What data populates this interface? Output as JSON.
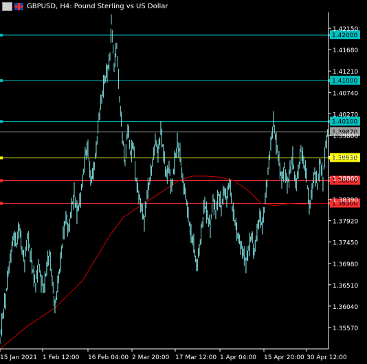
{
  "window": {
    "title": "GBPUSD, H4:  Pound Sterling vs US Dollar"
  },
  "colors": {
    "background": "#000000",
    "price": "#7fe3e3",
    "level_cyan": "#00c0c0",
    "level_yellow": "#ffff00",
    "level_red": "#ff3030",
    "ma": "#d00000",
    "axis_text": "#ffffff",
    "current_price_tag": "#a0a0a0"
  },
  "chart_data": {
    "type": "candlestick",
    "title": "GBPUSD, H4:  Pound Sterling vs US Dollar",
    "symbol": "GBPUSD",
    "timeframe": "H4",
    "ylim": [
      1.351,
      1.425
    ],
    "y_ticks": [
      "1.42150",
      "1.41680",
      "1.41210",
      "1.40740",
      "1.40270",
      "1.39800",
      "1.39330",
      "1.38860",
      "1.38390",
      "1.37920",
      "1.37450",
      "1.36980",
      "1.36510",
      "1.36040",
      "1.35570"
    ],
    "x_ticks": [
      "15 Jan 2021",
      "1 Feb 12:00",
      "16 Feb 04:00",
      "2 Mar 20:00",
      "17 Mar 12:00",
      "1 Apr 04:00",
      "15 Apr 20:00",
      "30 Apr 12:00"
    ],
    "horizontal_levels": [
      {
        "label": "1.42000",
        "value": 1.42,
        "color": "cyan"
      },
      {
        "label": "1.41000",
        "value": 1.41,
        "color": "cyan"
      },
      {
        "label": "1.40100",
        "value": 1.401,
        "color": "cyan"
      },
      {
        "label": "1.39930",
        "value": 1.393,
        "color": "yellow"
      },
      {
        "label": "1.38800",
        "value": 1.388,
        "color": "red"
      },
      {
        "label": "1.38300",
        "value": 1.383,
        "color": "red"
      }
    ],
    "current_price": {
      "label": "1.39870",
      "value": 1.3987
    },
    "price_path": [
      [
        0,
        1.353
      ],
      [
        4,
        1.358
      ],
      [
        8,
        1.362
      ],
      [
        12,
        1.368
      ],
      [
        16,
        1.372
      ],
      [
        20,
        1.376
      ],
      [
        24,
        1.374
      ],
      [
        28,
        1.378
      ],
      [
        32,
        1.373
      ],
      [
        36,
        1.37
      ],
      [
        40,
        1.376
      ],
      [
        44,
        1.372
      ],
      [
        48,
        1.368
      ],
      [
        52,
        1.365
      ],
      [
        56,
        1.37
      ],
      [
        60,
        1.366
      ],
      [
        64,
        1.364
      ],
      [
        68,
        1.369
      ],
      [
        72,
        1.372
      ],
      [
        76,
        1.366
      ],
      [
        80,
        1.36
      ],
      [
        84,
        1.365
      ],
      [
        88,
        1.37
      ],
      [
        92,
        1.376
      ],
      [
        96,
        1.38
      ],
      [
        100,
        1.377
      ],
      [
        104,
        1.382
      ],
      [
        108,
        1.385
      ],
      [
        112,
        1.381
      ],
      [
        116,
        1.383
      ],
      [
        120,
        1.388
      ],
      [
        124,
        1.394
      ],
      [
        128,
        1.395
      ],
      [
        132,
        1.388
      ],
      [
        136,
        1.39
      ],
      [
        140,
        1.395
      ],
      [
        144,
        1.402
      ],
      [
        148,
        1.406
      ],
      [
        152,
        1.41
      ],
      [
        156,
        1.412
      ],
      [
        160,
        1.415
      ],
      [
        162,
        1.4235
      ],
      [
        166,
        1.413
      ],
      [
        170,
        1.418
      ],
      [
        174,
        1.406
      ],
      [
        178,
        1.398
      ],
      [
        182,
        1.392
      ],
      [
        186,
        1.4
      ],
      [
        190,
        1.394
      ],
      [
        194,
        1.396
      ],
      [
        198,
        1.388
      ],
      [
        202,
        1.385
      ],
      [
        206,
        1.382
      ],
      [
        210,
        1.379
      ],
      [
        214,
        1.385
      ],
      [
        218,
        1.388
      ],
      [
        222,
        1.392
      ],
      [
        226,
        1.397
      ],
      [
        230,
        1.394
      ],
      [
        234,
        1.399
      ],
      [
        238,
        1.394
      ],
      [
        242,
        1.389
      ],
      [
        246,
        1.391
      ],
      [
        250,
        1.386
      ],
      [
        254,
        1.392
      ],
      [
        258,
        1.396
      ],
      [
        262,
        1.394
      ],
      [
        266,
        1.388
      ],
      [
        270,
        1.385
      ],
      [
        274,
        1.38
      ],
      [
        278,
        1.376
      ],
      [
        282,
        1.374
      ],
      [
        286,
        1.369
      ],
      [
        290,
        1.373
      ],
      [
        294,
        1.378
      ],
      [
        298,
        1.383
      ],
      [
        302,
        1.38
      ],
      [
        306,
        1.378
      ],
      [
        310,
        1.384
      ],
      [
        314,
        1.381
      ],
      [
        318,
        1.385
      ],
      [
        322,
        1.382
      ],
      [
        326,
        1.386
      ],
      [
        330,
        1.384
      ],
      [
        334,
        1.388
      ],
      [
        338,
        1.382
      ],
      [
        342,
        1.379
      ],
      [
        346,
        1.376
      ],
      [
        350,
        1.374
      ],
      [
        354,
        1.372
      ],
      [
        358,
        1.37
      ],
      [
        362,
        1.373
      ],
      [
        366,
        1.376
      ],
      [
        370,
        1.372
      ],
      [
        374,
        1.377
      ],
      [
        378,
        1.38
      ],
      [
        382,
        1.378
      ],
      [
        386,
        1.384
      ],
      [
        390,
        1.39
      ],
      [
        394,
        1.396
      ],
      [
        398,
        1.401
      ],
      [
        402,
        1.396
      ],
      [
        406,
        1.392
      ],
      [
        410,
        1.388
      ],
      [
        414,
        1.391
      ],
      [
        418,
        1.387
      ],
      [
        422,
        1.39
      ],
      [
        426,
        1.393
      ],
      [
        430,
        1.387
      ],
      [
        434,
        1.39
      ],
      [
        438,
        1.395
      ],
      [
        442,
        1.392
      ],
      [
        446,
        1.389
      ],
      [
        450,
        1.382
      ],
      [
        454,
        1.386
      ],
      [
        458,
        1.39
      ],
      [
        462,
        1.387
      ],
      [
        466,
        1.392
      ],
      [
        470,
        1.388
      ],
      [
        474,
        1.396
      ],
      [
        478,
        1.399
      ]
    ],
    "ma_path": [
      [
        0,
        1.351
      ],
      [
        40,
        1.356
      ],
      [
        80,
        1.36
      ],
      [
        100,
        1.363
      ],
      [
        120,
        1.366
      ],
      [
        140,
        1.371
      ],
      [
        160,
        1.376
      ],
      [
        180,
        1.38
      ],
      [
        200,
        1.382
      ],
      [
        220,
        1.384
      ],
      [
        240,
        1.386
      ],
      [
        260,
        1.388
      ],
      [
        280,
        1.389
      ],
      [
        300,
        1.389
      ],
      [
        320,
        1.3888
      ],
      [
        340,
        1.388
      ],
      [
        360,
        1.386
      ],
      [
        380,
        1.383
      ],
      [
        400,
        1.3825
      ],
      [
        420,
        1.383
      ],
      [
        440,
        1.3828
      ],
      [
        460,
        1.383
      ],
      [
        478,
        1.383
      ]
    ]
  }
}
